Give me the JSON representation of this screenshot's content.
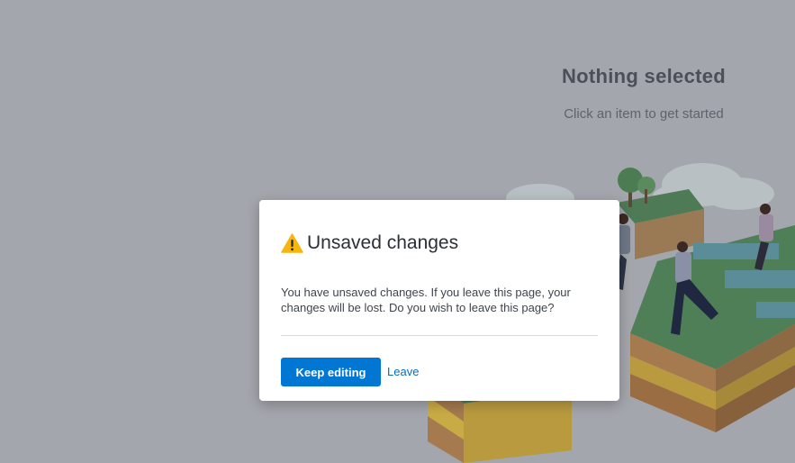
{
  "empty_state": {
    "title": "Nothing selected",
    "subtitle": "Click an item to get started"
  },
  "dialog": {
    "icon": "warning-icon",
    "title": "Unsaved changes",
    "message": "You have unsaved changes. If you leave this page, your changes will be lost. Do you wish to leave this page?",
    "primary_label": "Keep editing",
    "secondary_label": "Leave"
  },
  "colors": {
    "overlay": "#a3a6ac",
    "primary": "#0176d3",
    "warning": "#f6b60f"
  }
}
